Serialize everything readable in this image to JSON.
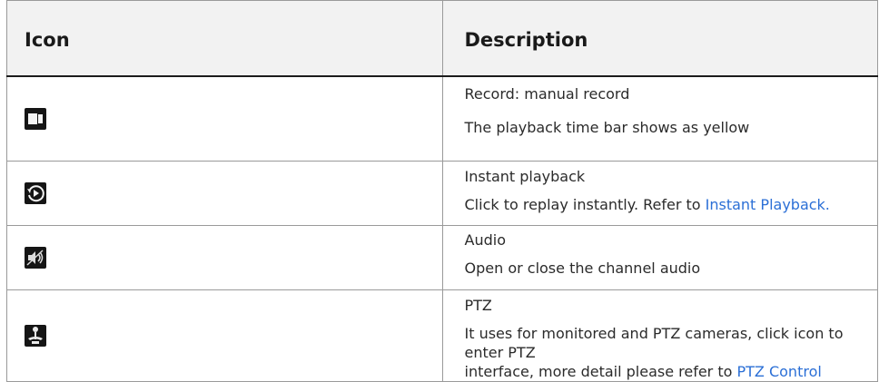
{
  "table": {
    "headers": {
      "icon": "Icon",
      "description": "Description"
    },
    "rows": [
      {
        "icon": "record-icon",
        "title": "Record: manual record",
        "detail": "The playback time bar shows as yellow"
      },
      {
        "icon": "instant-playback-icon",
        "title": "Instant playback",
        "detail": "Click to replay instantly. Refer to ",
        "link": "Instant Playback."
      },
      {
        "icon": "audio-muted-icon",
        "title": "Audio",
        "detail": "Open or close the channel audio"
      },
      {
        "icon": "ptz-icon",
        "title": "PTZ",
        "detail_line1": "It uses for monitored and PTZ cameras, click icon to enter PTZ",
        "detail_line2": "interface, more detail please refer to ",
        "link": "PTZ Control"
      }
    ]
  }
}
